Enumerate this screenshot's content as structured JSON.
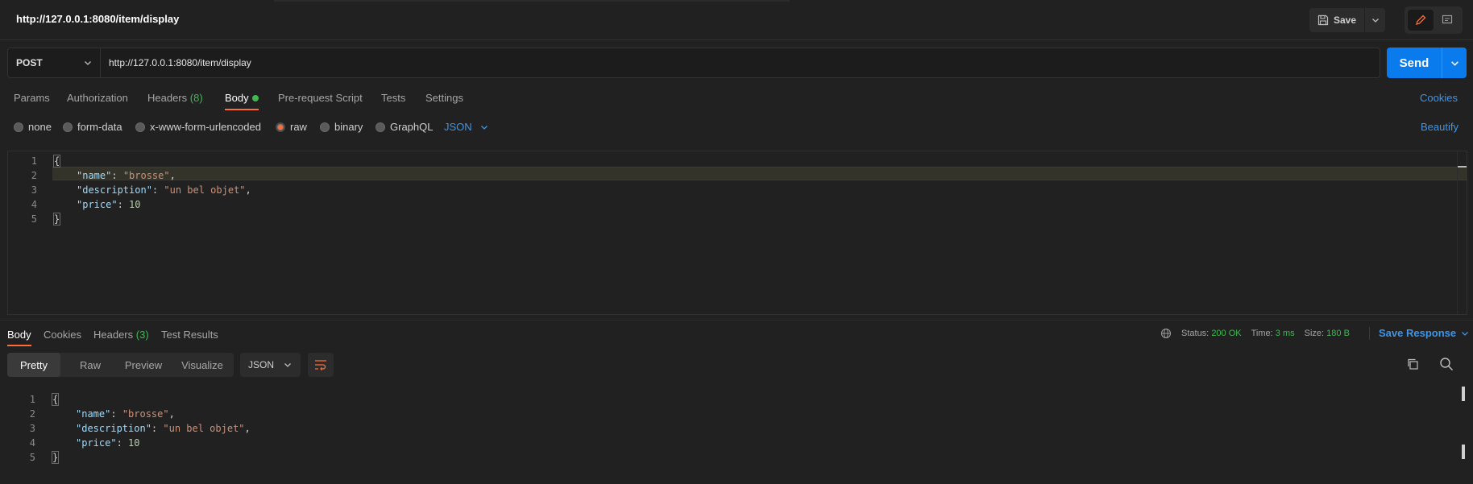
{
  "window": {
    "title": "http://127.0.0.1:8080/item/display"
  },
  "toolbar": {
    "save_label": "Save"
  },
  "request": {
    "method": "POST",
    "url": "http://127.0.0.1:8080/item/display",
    "send_label": "Send",
    "tabs": {
      "params": "Params",
      "authorization": "Authorization",
      "headers": "Headers",
      "headers_count": "(8)",
      "body": "Body",
      "prerequest": "Pre-request Script",
      "tests": "Tests",
      "settings": "Settings"
    },
    "cookies_label": "Cookies",
    "body_types": {
      "none": "none",
      "form_data": "form-data",
      "urlencoded": "x-www-form-urlencoded",
      "raw": "raw",
      "binary": "binary",
      "graphql": "GraphQL"
    },
    "selected_body_type": "raw",
    "raw_format": "JSON",
    "beautify_label": "Beautify",
    "body_lines": [
      {
        "no": "1",
        "text": "{"
      },
      {
        "no": "2",
        "key": "\"name\"",
        "value": "\"brosse\"",
        "tail": ","
      },
      {
        "no": "3",
        "key": "\"description\"",
        "value": "\"un bel objet\"",
        "tail": ","
      },
      {
        "no": "4",
        "key": "\"price\"",
        "value": "10",
        "tail": ""
      },
      {
        "no": "5",
        "text": "}"
      }
    ]
  },
  "response": {
    "tabs": {
      "body": "Body",
      "cookies": "Cookies",
      "headers": "Headers",
      "headers_count": "(3)",
      "test_results": "Test Results"
    },
    "status_label": "Status:",
    "status_value": "200 OK",
    "time_label": "Time:",
    "time_value": "3 ms",
    "size_label": "Size:",
    "size_value": "180 B",
    "save_response_label": "Save Response",
    "views": {
      "pretty": "Pretty",
      "raw": "Raw",
      "preview": "Preview",
      "visualize": "Visualize"
    },
    "format": "JSON",
    "body_lines": [
      {
        "no": "1",
        "text": "{"
      },
      {
        "no": "2",
        "key": "\"name\"",
        "value": "\"brosse\"",
        "tail": ","
      },
      {
        "no": "3",
        "key": "\"description\"",
        "value": "\"un bel objet\"",
        "tail": ","
      },
      {
        "no": "4",
        "key": "\"price\"",
        "value": "10",
        "tail": ""
      },
      {
        "no": "5",
        "text": "}"
      }
    ]
  },
  "colors": {
    "accent_orange": "#ff6c37",
    "send_blue": "#097bed",
    "link_blue": "#3f94e8",
    "success_green": "#3fb950"
  },
  "icons": {
    "save": "floppy-disk-icon",
    "edit": "pencil-icon",
    "comment": "comment-icon",
    "globe": "globe-icon",
    "wrap": "wrap-lines-icon",
    "copy": "copy-icon",
    "search": "search-icon"
  }
}
